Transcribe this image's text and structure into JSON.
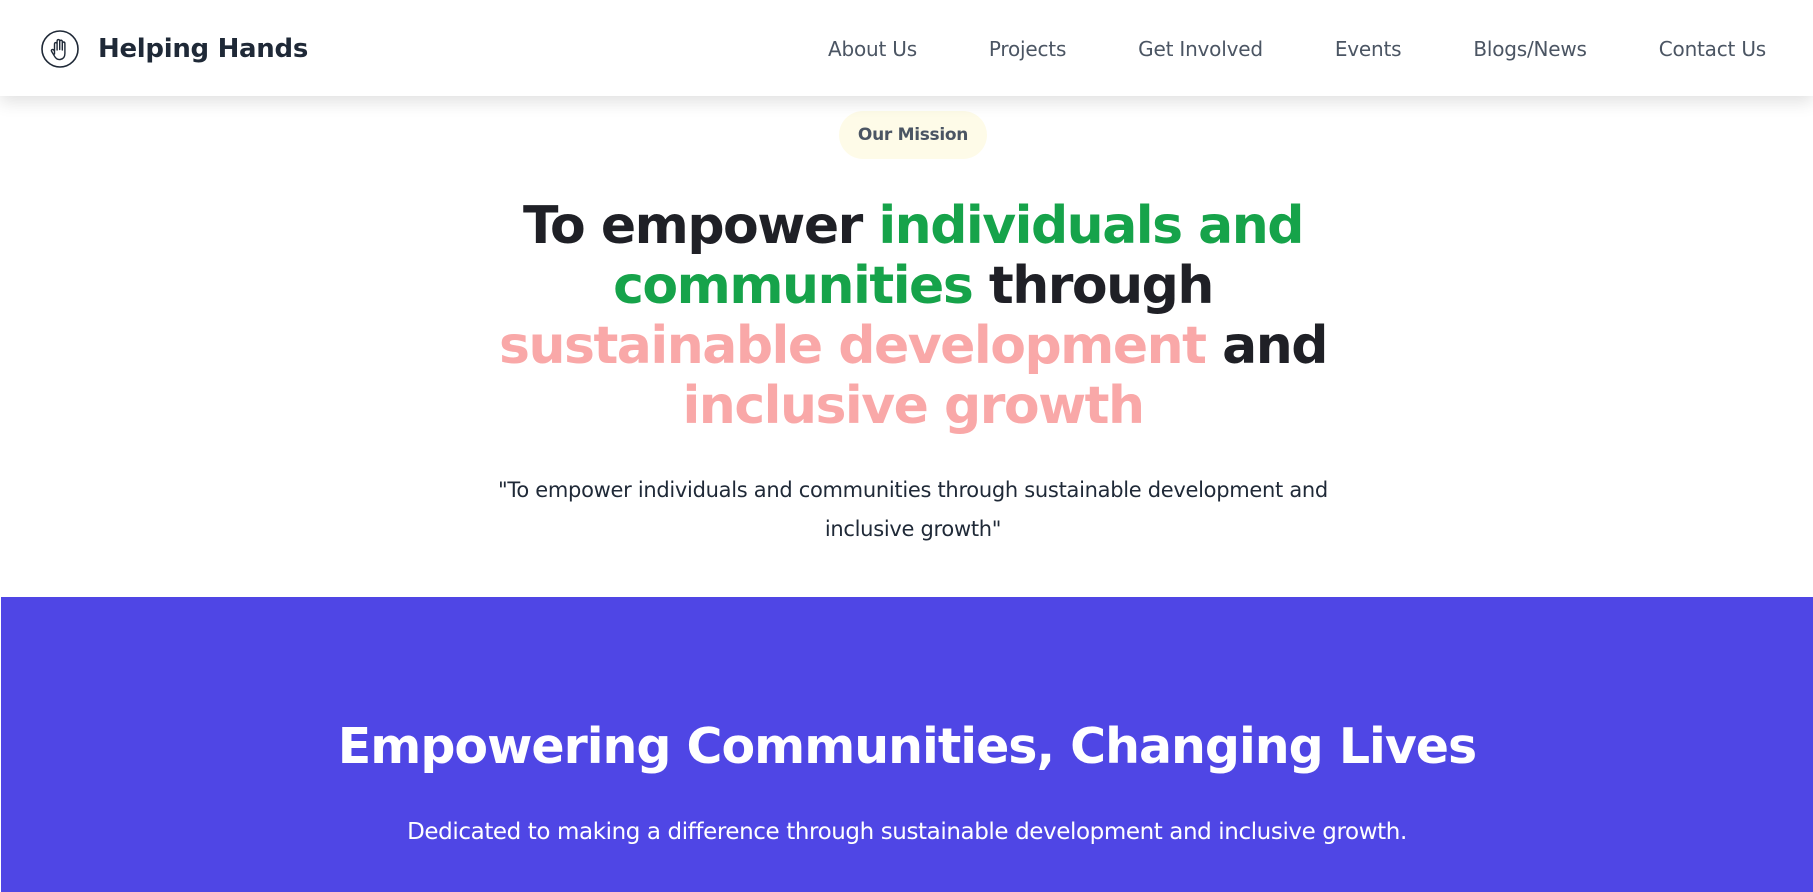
{
  "header": {
    "brand": {
      "name": "Helping Hands",
      "icon": "hand-icon"
    },
    "nav": [
      {
        "label": "About Us"
      },
      {
        "label": "Projects"
      },
      {
        "label": "Get Involved"
      },
      {
        "label": "Events"
      },
      {
        "label": "Blogs/News"
      },
      {
        "label": "Contact Us"
      }
    ]
  },
  "mission": {
    "badge": "Our Mission",
    "headline": {
      "part1": "To empower ",
      "part2": "individuals and",
      "part3": "communities",
      "part4": " through",
      "part5": "sustainable development",
      "part6": " and",
      "part7": "inclusive growth"
    },
    "quote": "\"To empower individuals and communities through sustainable development and inclusive growth\""
  },
  "hero": {
    "title": "Empowering Communities, Changing Lives",
    "subtitle": "Dedicated to making a difference through sustainable development and inclusive growth."
  },
  "colors": {
    "accent_green": "#16a34a",
    "accent_pink": "#f9a8a8",
    "hero_bg": "#4f46e5",
    "badge_bg": "#fefbe8",
    "text_dark": "#1f2026",
    "nav_text": "#4b5563"
  }
}
